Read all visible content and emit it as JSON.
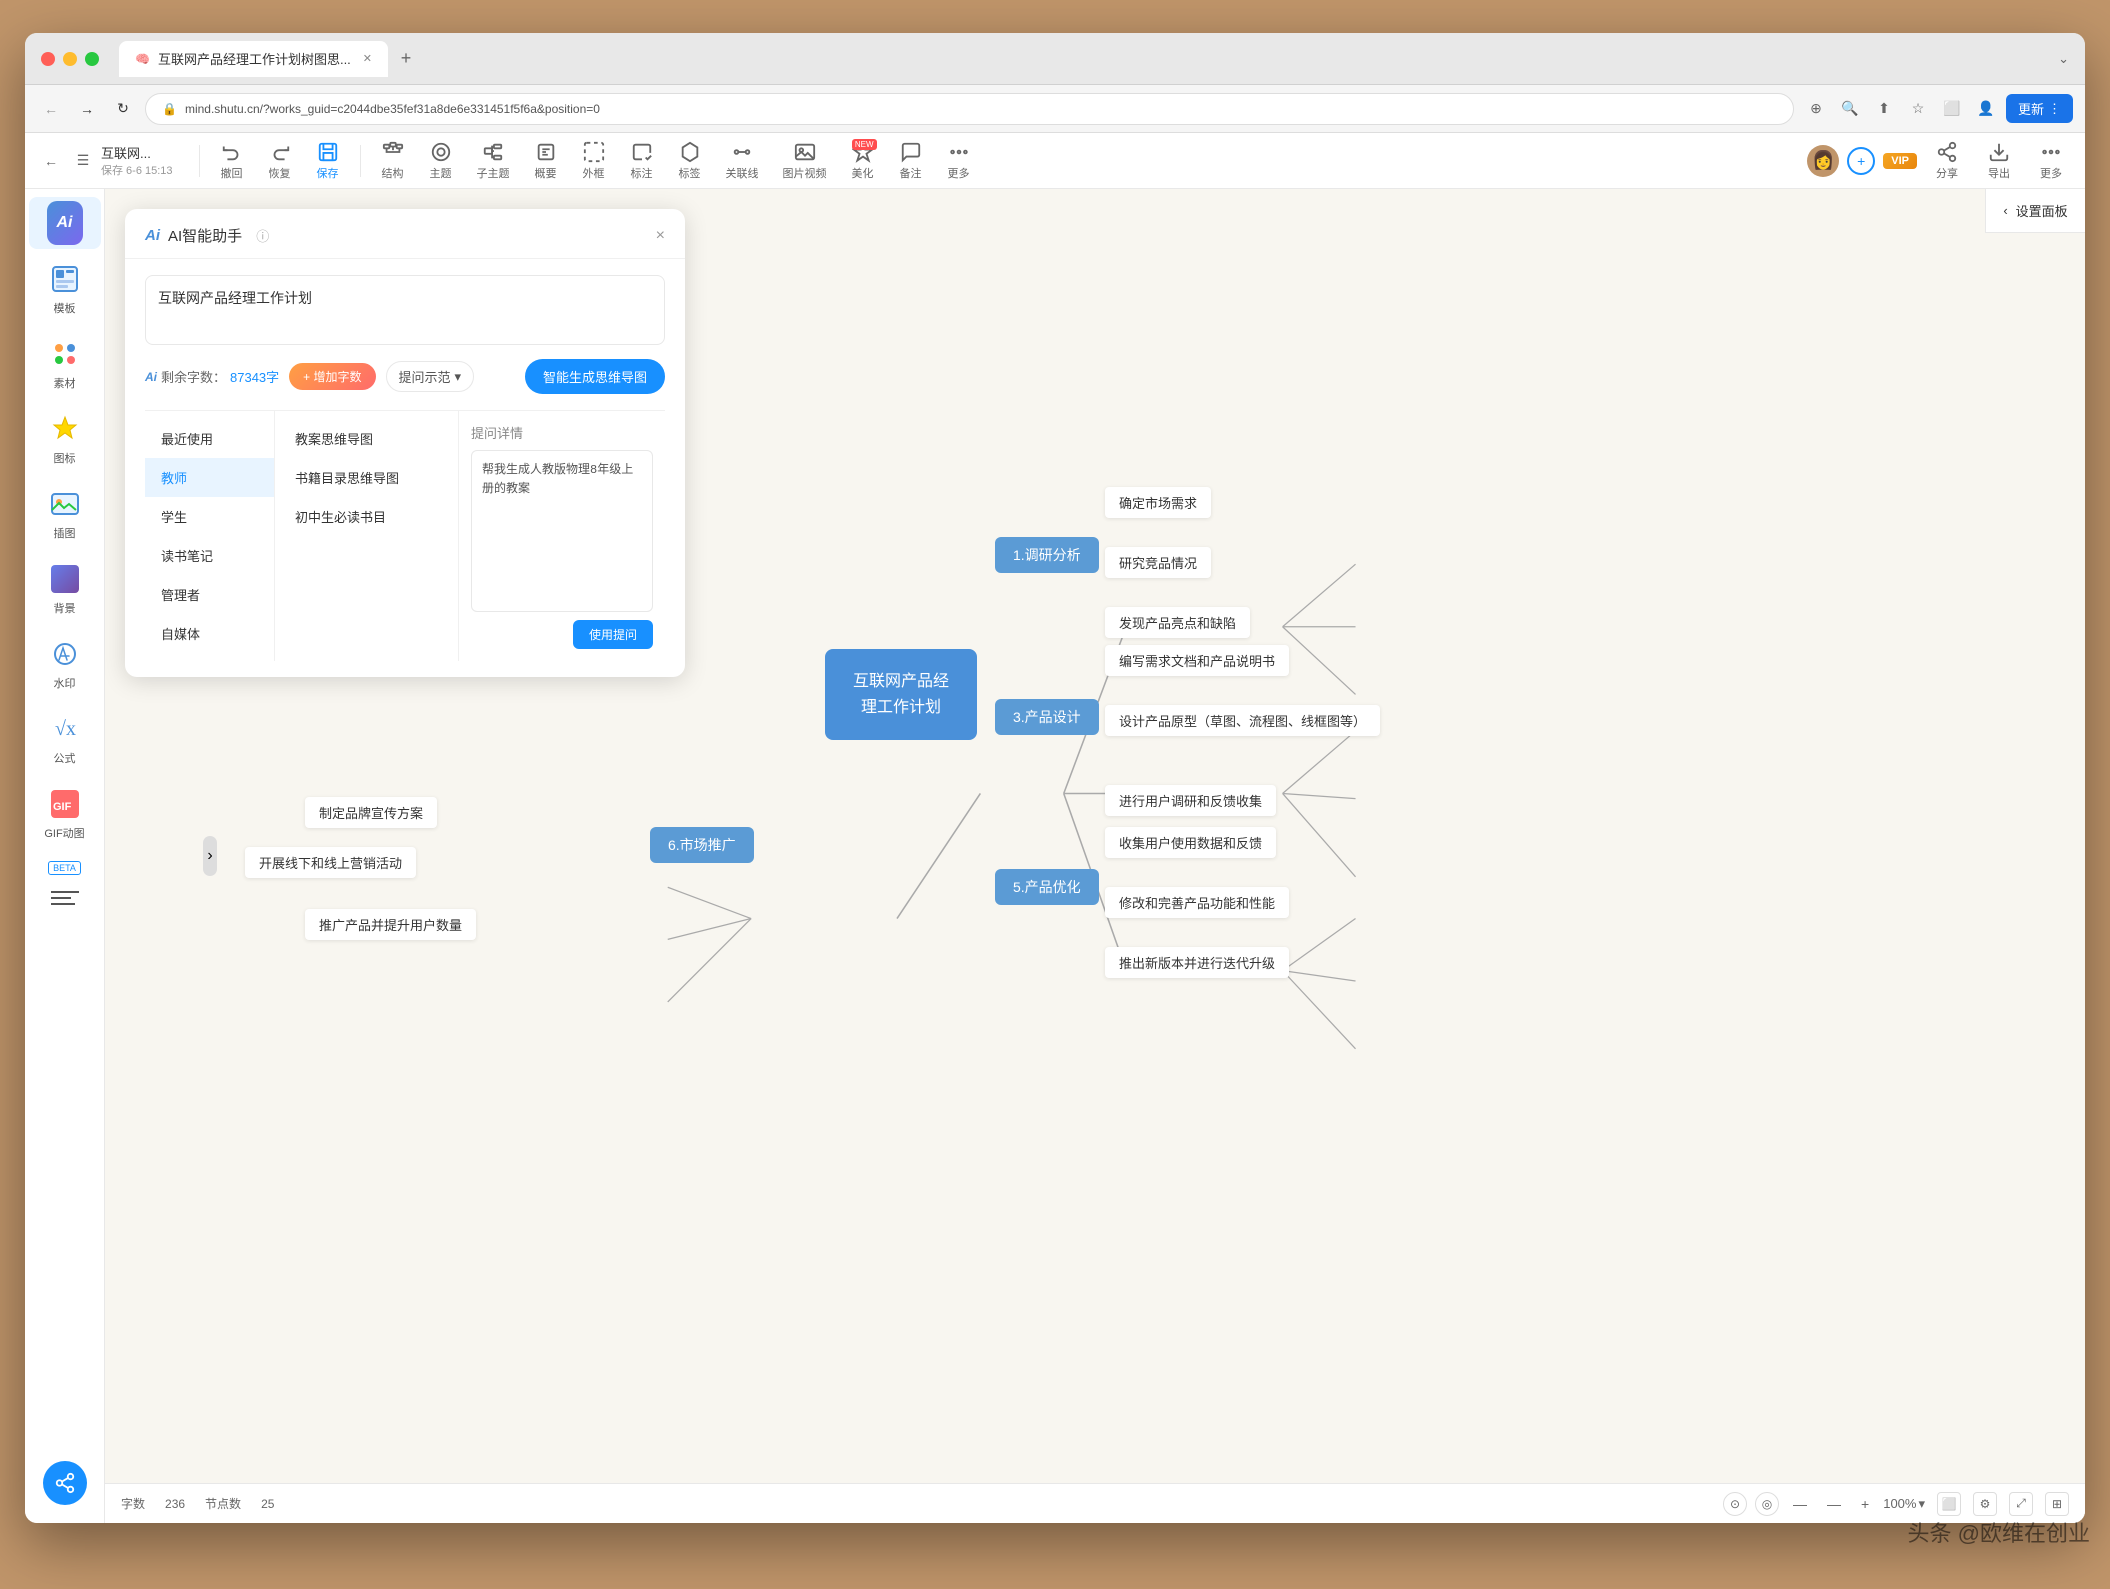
{
  "window": {
    "title": "互联网产品经理工作计划树图思...",
    "url": "mind.shutu.cn/?works_guid=c2044dbe35fef31a8de6e331451f5f6a&position=0",
    "tab_label": "互联网产品经理工作计划树图思...",
    "update_btn": "更新"
  },
  "app_toolbar": {
    "back_label": "互联网...",
    "save_status": "保存 6-6 15:13",
    "undo_label": "撤回",
    "redo_label": "恢复",
    "save_label": "保存",
    "structure_label": "结构",
    "theme_label": "主题",
    "subtheme_label": "子主题",
    "outline_label": "概要",
    "frame_label": "外框",
    "note_label": "标注",
    "tag_label": "标签",
    "relation_label": "关联线",
    "media_label": "图片视频",
    "beautify_label": "美化",
    "backup_label": "备注",
    "more_label": "更多",
    "share_label": "分享",
    "export_label": "导出",
    "more2_label": "更多",
    "vip_label": "VIP"
  },
  "sidebar": {
    "items": [
      {
        "label": "AI",
        "icon": "ai"
      },
      {
        "label": "模板",
        "icon": "template"
      },
      {
        "label": "素材",
        "icon": "material"
      },
      {
        "label": "图标",
        "icon": "icon"
      },
      {
        "label": "插图",
        "icon": "illustration"
      },
      {
        "label": "背景",
        "icon": "background"
      },
      {
        "label": "水印",
        "icon": "watermark"
      },
      {
        "label": "公式",
        "icon": "formula"
      },
      {
        "label": "GIF动图",
        "icon": "gif"
      },
      {
        "label": "BETA",
        "icon": "beta"
      }
    ]
  },
  "ai_panel": {
    "title": "AI智能助手",
    "close": "×",
    "input_text": "互联网产品经理工作计划",
    "remaining_label": "剩余字数：",
    "remaining_count": "87343字",
    "add_count_label": "+ 增加字数",
    "prompt_select_label": "提问示范",
    "generate_btn": "智能生成思维导图",
    "categories": [
      {
        "label": "最近使用"
      },
      {
        "label": "教师",
        "active": true
      },
      {
        "label": "学生"
      },
      {
        "label": "读书笔记"
      },
      {
        "label": "管理者"
      },
      {
        "label": "自媒体"
      }
    ],
    "templates": [
      {
        "label": "教案思维导图"
      },
      {
        "label": "书籍目录思维导图"
      },
      {
        "label": "初中生必读书目"
      }
    ],
    "prompt_detail_title": "提问详情",
    "prompt_detail_text": "帮我生成人教版物理8年级上册的教案",
    "use_prompt_btn": "使用提问"
  },
  "mindmap": {
    "center_node": "互联网产品经\n理工作计划",
    "branches": [
      {
        "label": "1.调研分析",
        "children": [
          "确定市场需求",
          "研究竞品情况",
          "发现产品亮点和缺陷"
        ]
      },
      {
        "label": "3.产品设计",
        "children": [
          "编写需求文档和产品说明书",
          "设计产品原型（草图、流程图、线框图等）",
          "进行用户调研和反馈收集"
        ]
      },
      {
        "label": "5.产品优化",
        "children": [
          "收集用户使用数据和反馈",
          "修改和完善产品功能和性能",
          "推出新版本并进行迭代升级"
        ]
      },
      {
        "label": "6.市场推广",
        "children": [
          "制定品牌宣传方案",
          "开展线下和线上营销活动",
          "推广产品并提升用户数量"
        ]
      }
    ]
  },
  "status_bar": {
    "word_count_label": "字数",
    "word_count": "236",
    "node_count_label": "节点数",
    "node_count": "25",
    "zoom_level": "100%",
    "settings_panel": "设置面板"
  },
  "watermark": {
    "text": "头条 @欧维在创业"
  }
}
